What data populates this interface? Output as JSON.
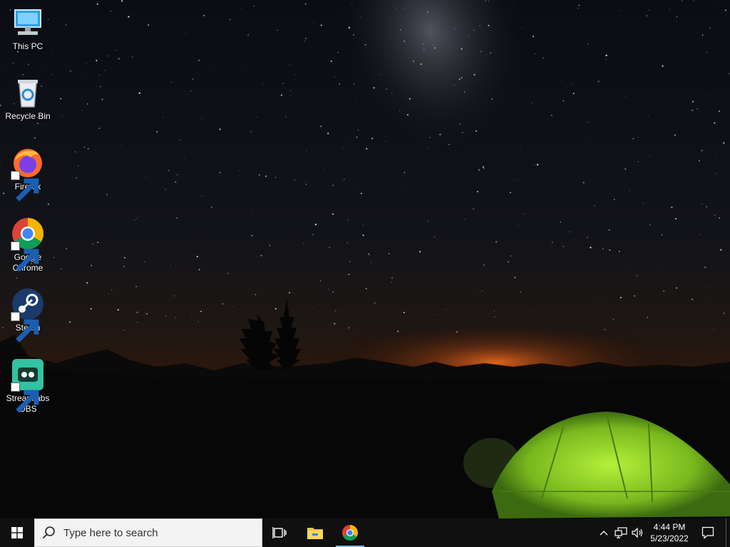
{
  "desktop": {
    "icons": [
      {
        "label": "This PC",
        "icon": "computer-icon"
      },
      {
        "label": "Recycle Bin",
        "icon": "recycle-bin-icon"
      },
      {
        "label": "Firefox",
        "icon": "firefox-icon",
        "shortcut": true
      },
      {
        "label": "Google Chrome",
        "icon": "chrome-icon",
        "shortcut": true
      },
      {
        "label": "Steam",
        "icon": "steam-icon",
        "shortcut": true
      },
      {
        "label": "Streamlabs OBS",
        "icon": "streamlabs-obs-icon",
        "shortcut": true
      }
    ],
    "wallpaper": "night-sky-milky-way-tent"
  },
  "taskbar": {
    "search_placeholder": "Type here to search",
    "pinned": [
      {
        "name": "Task View",
        "icon": "task-view-icon"
      },
      {
        "name": "File Explorer",
        "icon": "file-explorer-icon"
      },
      {
        "name": "Google Chrome",
        "icon": "chrome-icon",
        "active": true
      }
    ],
    "tray": {
      "icons": [
        "chevron-up-icon",
        "network-icon",
        "volume-icon",
        "notification-icon"
      ]
    },
    "clock": {
      "time": "4:44 PM",
      "date": "5/23/2022"
    }
  },
  "colors": {
    "taskbar_bg": "#101010",
    "search_bg": "#f3f3f3",
    "active_indicator": "#76b9ed",
    "tent_green": "#8fd12a"
  }
}
